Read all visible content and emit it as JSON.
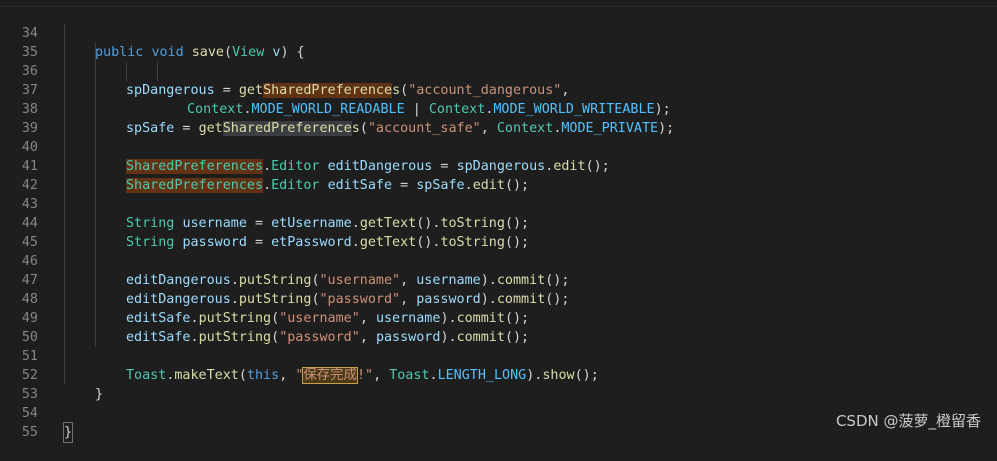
{
  "lines": [
    {
      "n": "34",
      "t": "public void save(View v) {"
    },
    {
      "n": "35",
      "t": ""
    },
    {
      "n": "36",
      "t": "spDangerous = getSharedPreferences(\"account_dangerous\","
    },
    {
      "n": "37",
      "t": "Context.MODE_WORLD_READABLE | Context.MODE_WORLD_WRITEABLE);"
    },
    {
      "n": "38",
      "t": "spSafe = getSharedPreferences(\"account_safe\", Context.MODE_PRIVATE);"
    },
    {
      "n": "39",
      "t": ""
    },
    {
      "n": "40",
      "t": "SharedPreferences.Editor editDangerous = spDangerous.edit();"
    },
    {
      "n": "41",
      "t": "SharedPreferences.Editor editSafe = spSafe.edit();"
    },
    {
      "n": "42",
      "t": ""
    },
    {
      "n": "43",
      "t": "String username = etUsername.getText().toString();"
    },
    {
      "n": "44",
      "t": "String password = etPassword.getText().toString();"
    },
    {
      "n": "45",
      "t": ""
    },
    {
      "n": "46",
      "t": "editDangerous.putString(\"username\", username).commit();"
    },
    {
      "n": "47",
      "t": "editDangerous.putString(\"password\", password).commit();"
    },
    {
      "n": "48",
      "t": "editSafe.putString(\"username\", username).commit();"
    },
    {
      "n": "49",
      "t": "editSafe.putString(\"password\", password).commit();"
    },
    {
      "n": "50",
      "t": ""
    },
    {
      "n": "51",
      "t": "Toast.makeText(this, \"保存完成!\", Toast.LENGTH_LONG).show();"
    },
    {
      "n": "52",
      "t": "}"
    },
    {
      "n": "53",
      "t": ""
    },
    {
      "n": "54",
      "t": "}"
    },
    {
      "n": "55",
      "t": ""
    }
  ],
  "watermark": "CSDN @菠萝_橙留香",
  "colors": {
    "background": "#1e1e1e",
    "keyword": "#569cd6",
    "function": "#dcdcaa",
    "type": "#4ec9b0",
    "string": "#ce9178",
    "variable": "#9cdcfe",
    "constant": "#4fc1ff"
  }
}
